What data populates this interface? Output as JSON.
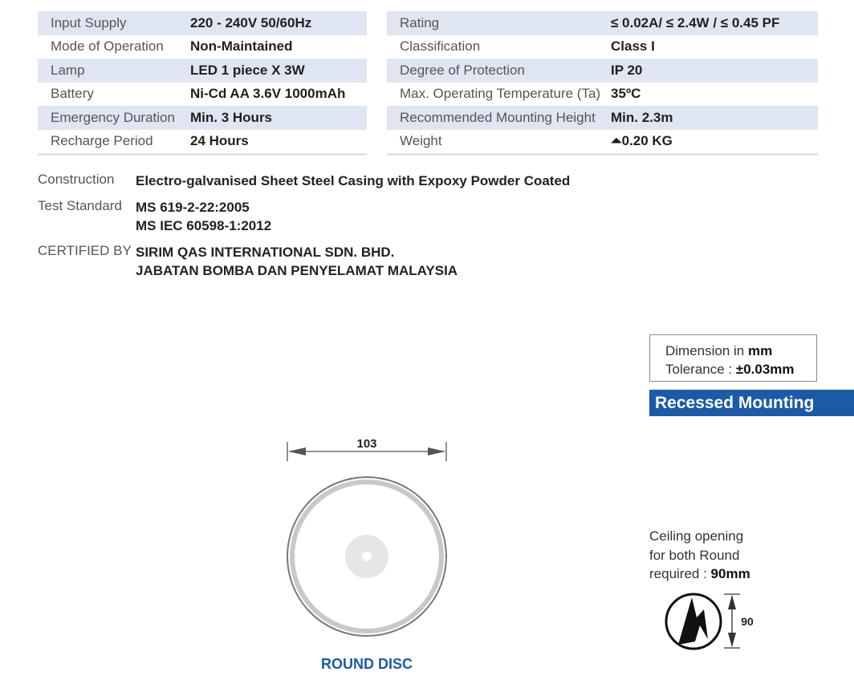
{
  "spec_left": [
    {
      "label": "Input Supply",
      "value": "220 - 240V 50/60Hz"
    },
    {
      "label": "Mode of Operation",
      "value": "Non-Maintained"
    },
    {
      "label": "Lamp",
      "value": "LED 1 piece X 3W"
    },
    {
      "label": "Battery",
      "value": "Ni-Cd AA 3.6V 1000mAh"
    },
    {
      "label": "Emergency Duration",
      "value": "Min. 3 Hours"
    },
    {
      "label": "Recharge Period",
      "value": "24 Hours"
    }
  ],
  "spec_right": [
    {
      "label": "Rating",
      "value": "≤ 0.02A/ ≤ 2.4W / ≤ 0.45 PF"
    },
    {
      "label": "Classification",
      "value": "Class I"
    },
    {
      "label": "Degree of Protection",
      "value": "IP 20"
    },
    {
      "label": "Max. Operating Temperature (Ta)",
      "value": "35ºC"
    },
    {
      "label": "Recommended Mounting Height",
      "value": "Min. 2.3m"
    },
    {
      "label": "Weight",
      "value": "⏶0.20 KG"
    }
  ],
  "construction": {
    "label": "Construction",
    "value": "Electro-galvanised Sheet Steel Casing with Expoxy Powder Coated"
  },
  "test_standard": {
    "label": "Test Standard",
    "values": [
      "MS 619-2-22:2005",
      "MS IEC 60598-1:2012"
    ]
  },
  "certified_by": {
    "label": "CERTIFIED BY",
    "values": [
      "SIRIM QAS INTERNATIONAL SDN. BHD.",
      "JABATAN BOMBA DAN PENYELAMAT MALAYSIA"
    ]
  },
  "dimension_box": {
    "line1_prefix": "Dimension in ",
    "line1_unit": "mm",
    "line2_prefix": "Tolerance : ",
    "line2_value": "±0.03mm"
  },
  "banner": "Recessed Mounting",
  "ceiling_note": {
    "line1": "Ceiling opening",
    "line2": "for both Round",
    "line3_prefix": "required : ",
    "line3_value": "90mm"
  },
  "hole_dimension": "90",
  "disc_dimension": "103",
  "disc_title": "ROUND DISC",
  "colors": {
    "accent": "#1c5aa6",
    "row_shade": "#dfe6f2"
  }
}
